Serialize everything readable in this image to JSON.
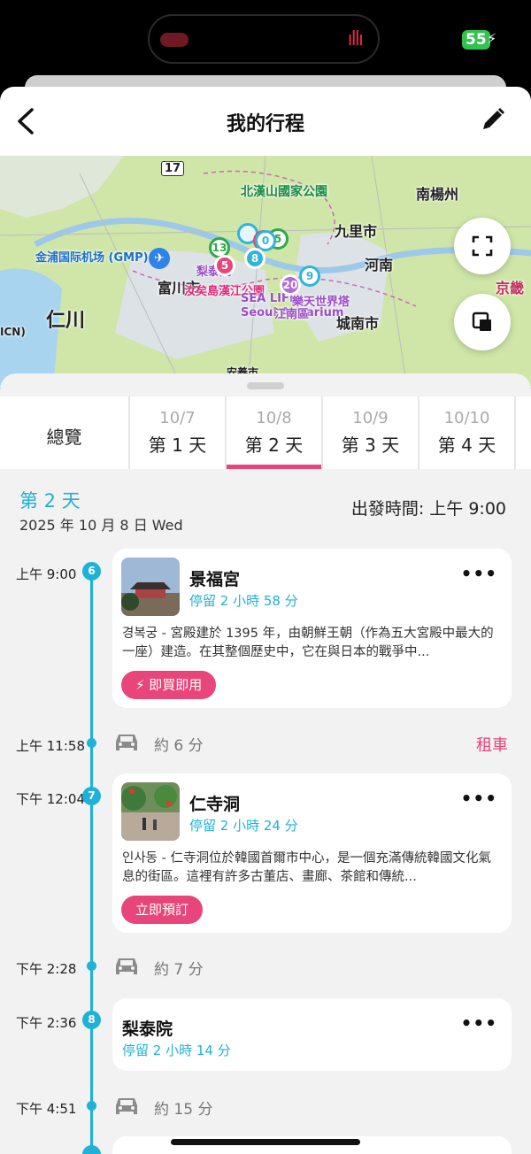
{
  "status": {
    "battery": "55"
  },
  "header": {
    "title": "我的行程"
  },
  "map": {
    "labels": {
      "route17": "17",
      "park": "北漢山國家公園",
      "namyangju": "南楊州",
      "guri": "九里市",
      "hanam": "河南",
      "gimpo_airport": "金浦国际机场 (GMP)",
      "bucheon": "富川市",
      "incheon": "仁川",
      "icn": "ICN)",
      "yeouido": "汝矣島漢江公園",
      "sealife": "SEA LIFE",
      "lotte_tower": "樂天世界塔",
      "aquarium": "Seoul Aquarium",
      "gangnam": "江南區",
      "seongnam": "城南市",
      "gyeonggi": "京畿",
      "itaewon_map": "梨泰院",
      "anyang": "安養市"
    },
    "pins": [
      "13",
      "5",
      "5",
      "0",
      "8",
      "9",
      "20"
    ]
  },
  "tabs": {
    "overview": "總覽",
    "days": [
      {
        "date": "10/7",
        "label": "第 1 天"
      },
      {
        "date": "10/8",
        "label": "第 2 天"
      },
      {
        "date": "10/9",
        "label": "第 3 天"
      },
      {
        "date": "10/10",
        "label": "第 4 天"
      }
    ]
  },
  "day": {
    "title": "第 2 天",
    "date": "2025 年 10 月 8 日 Wed",
    "depart": "出發時間:  上午 9:00"
  },
  "timeline": {
    "stops": [
      {
        "time": "上午 9:00",
        "index": "6",
        "name": "景福宮",
        "stay": "停留 2 小時 58 分",
        "desc": "경복궁 - 宮殿建於 1395 年，由朝鮮王朝（作為五大宮殿中最大的一座）建造。在其整個歷史中，它在與日本的戰爭中...",
        "action": "⚡ 即買即用",
        "more": "•••"
      },
      {
        "time": "下午 12:04",
        "index": "7",
        "name": "仁寺洞",
        "stay": "停留 2 小時 24 分",
        "desc": "인사동 - 仁寺洞位於韓國首爾市中心，是一個充滿傳統韓國文化氣息的街區。這裡有許多古董店、畫廊、茶館和傳統...",
        "action": "立即預訂",
        "more": "•••"
      },
      {
        "time": "下午 2:36",
        "index": "8",
        "name": "梨泰院",
        "stay": "停留 2 小時 14 分",
        "more": "•••"
      }
    ],
    "transits": [
      {
        "time": "上午 11:58",
        "duration": "約 6 分",
        "extra": "租車"
      },
      {
        "time": "下午 2:28",
        "duration": "約 7 分"
      },
      {
        "time": "下午 4:51",
        "duration": "約 15 分"
      }
    ]
  },
  "colors": {
    "accent_pink": "#e8457a",
    "accent_cyan": "#1fb2d6"
  }
}
